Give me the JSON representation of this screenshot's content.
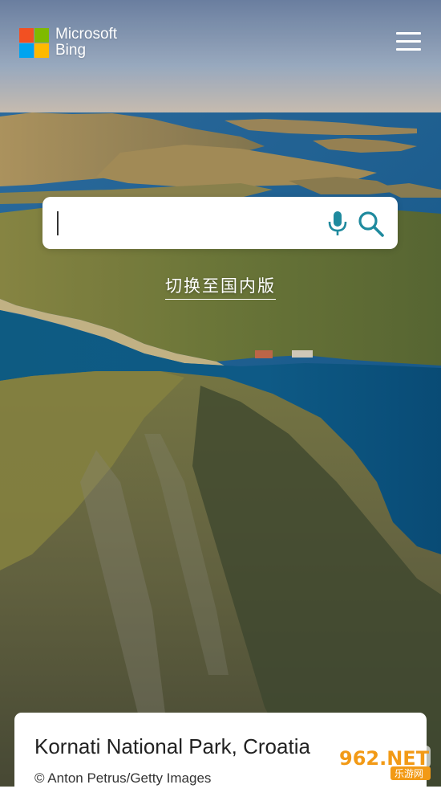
{
  "brand": {
    "line1": "Microsoft",
    "line2": "Bing",
    "colors": [
      "#f25022",
      "#7fba00",
      "#00a4ef",
      "#ffb900"
    ]
  },
  "header": {
    "menu_icon": "hamburger-menu-icon"
  },
  "search": {
    "value": "",
    "placeholder": "",
    "mic_icon": "microphone-icon",
    "search_icon": "search-icon",
    "accent_color": "#1f8a9e"
  },
  "switch_link": {
    "label": "切换至国内版"
  },
  "image_caption": {
    "title": "Kornati National Park, Croatia",
    "credit": "© Anton Petrus/Getty Images"
  },
  "watermark": {
    "main": "962.NET",
    "sub": "乐游网"
  }
}
